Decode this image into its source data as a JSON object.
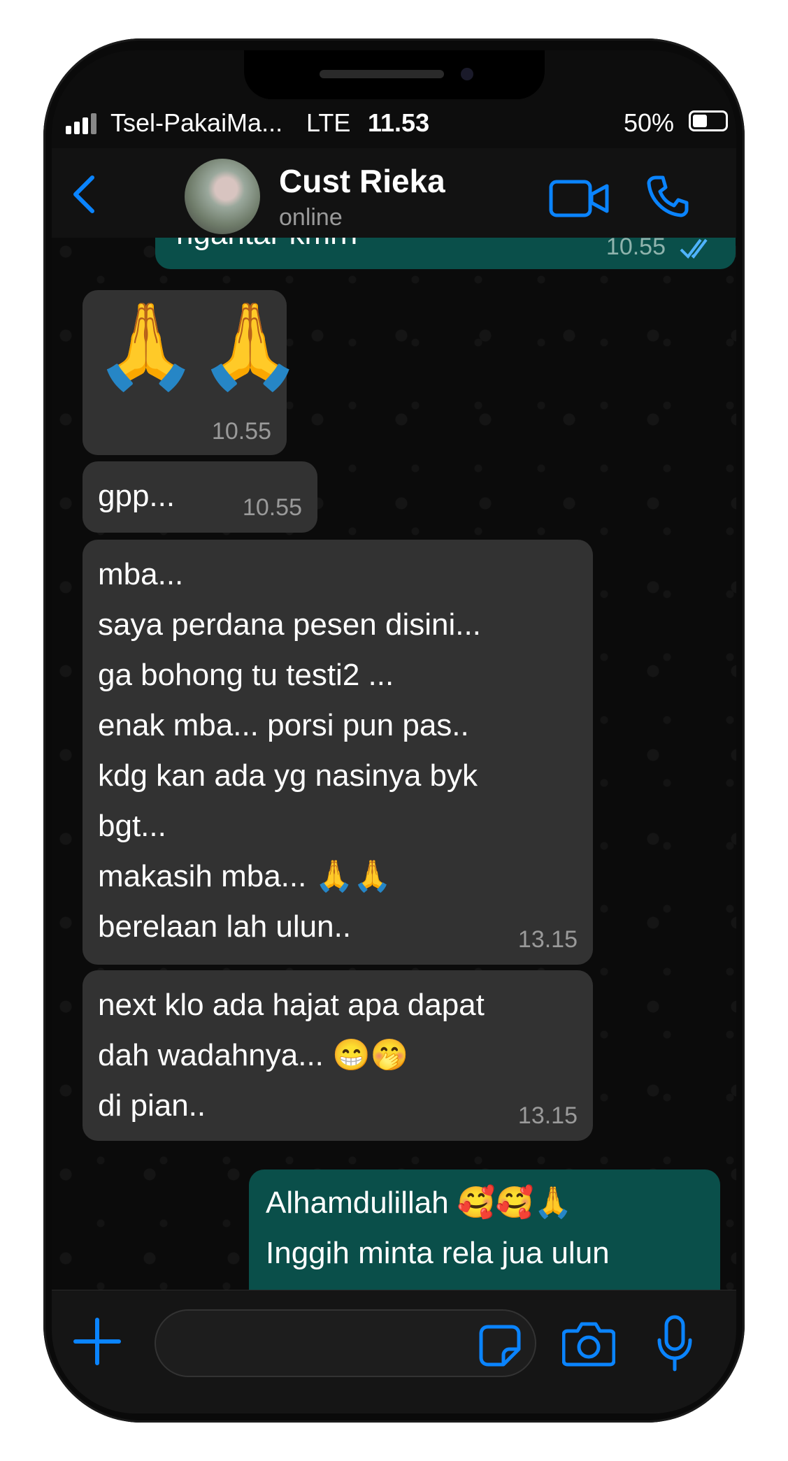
{
  "status_bar": {
    "carrier": "Tsel-PakaiMa...",
    "network": "LTE",
    "time": "11.53",
    "battery": "50%"
  },
  "header": {
    "contact_name": "Cust Rieka",
    "contact_status": "online",
    "icons": [
      "back-chevron-icon",
      "video-call-icon",
      "voice-call-icon"
    ],
    "accent_color": "#0a84ff"
  },
  "messages": [
    {
      "direction": "out",
      "lines": [
        "ngantar kmrn"
      ],
      "time": "10.55",
      "read": true
    },
    {
      "direction": "in",
      "lines": [
        "🙏🙏"
      ],
      "time": "10.55"
    },
    {
      "direction": "in",
      "lines": [
        "gpp..."
      ],
      "time": "10.55"
    },
    {
      "direction": "in",
      "lines": [
        "mba...",
        "saya perdana pesen disini...",
        "ga bohong tu testi2 ...",
        "enak mba... porsi pun pas..",
        "kdg kan ada yg nasinya byk",
        "bgt...",
        "makasih mba... 🙏🙏",
        "berelaan lah ulun.."
      ],
      "time": "13.15"
    },
    {
      "direction": "in",
      "lines": [
        "next klo ada hajat apa dapat",
        "dah wadahnya... 😁🤭",
        "di pian.."
      ],
      "time": "13.15"
    },
    {
      "direction": "out",
      "lines": [
        "Alhamdulillah 🥰🥰🙏",
        "Inggih minta rela jua ulun"
      ]
    }
  ],
  "composer": {
    "placeholder": "",
    "icons": [
      "plus-icon",
      "sticker-icon",
      "camera-icon",
      "microphone-icon"
    ]
  },
  "colors": {
    "incoming_bubble": "#323232",
    "outgoing_bubble": "#0a4f4a",
    "background": "#0b0b0b"
  }
}
